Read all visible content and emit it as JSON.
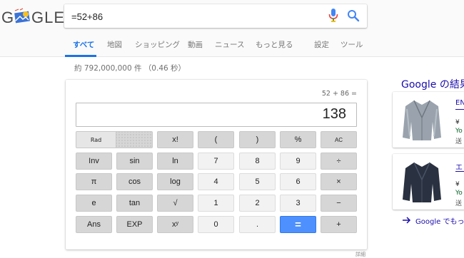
{
  "header": {
    "logo_text_left": "G",
    "logo_text_right": "GLE",
    "search": {
      "value": "=52+86",
      "placeholder": ""
    },
    "icons": {
      "mic": "microphone-icon",
      "search": "search-icon"
    }
  },
  "tabs": [
    {
      "label": "すべて",
      "active": true
    },
    {
      "label": "地図"
    },
    {
      "label": "ショッピング"
    },
    {
      "label": "動画"
    },
    {
      "label": "ニュース"
    },
    {
      "label": "もっと見る"
    },
    {
      "label": "設定"
    },
    {
      "label": "ツール"
    }
  ],
  "stats": "約 792,000,000 件 （0.46 秒）",
  "calculator": {
    "history": "52 + 86 =",
    "result": "138",
    "toggle": {
      "rad": "Rad",
      "deg": ""
    },
    "rows": [
      [
        "x!",
        "(",
        ")",
        "%",
        "AC"
      ],
      [
        "Inv",
        "sin",
        "ln",
        "7",
        "8",
        "9",
        "÷"
      ],
      [
        "π",
        "cos",
        "log",
        "4",
        "5",
        "6",
        "×"
      ],
      [
        "e",
        "tan",
        "√",
        "1",
        "2",
        "3",
        "−"
      ],
      [
        "Ans",
        "EXP",
        "xʸ",
        "0",
        ".",
        "=",
        "+"
      ]
    ],
    "details": "詳細"
  },
  "sidebar": {
    "title": "Google の結果",
    "products": [
      {
        "name": "EN",
        "price": "¥",
        "store": "Yo",
        "ship": "送"
      },
      {
        "name": "エ",
        "price": "¥",
        "store": "Yo",
        "ship": "送"
      }
    ],
    "more": "Google でもっと見る"
  },
  "colors": {
    "accent": "#1a73e8",
    "equals": "#4d90fe",
    "link": "#1a0dab",
    "store": "#0d652d"
  }
}
